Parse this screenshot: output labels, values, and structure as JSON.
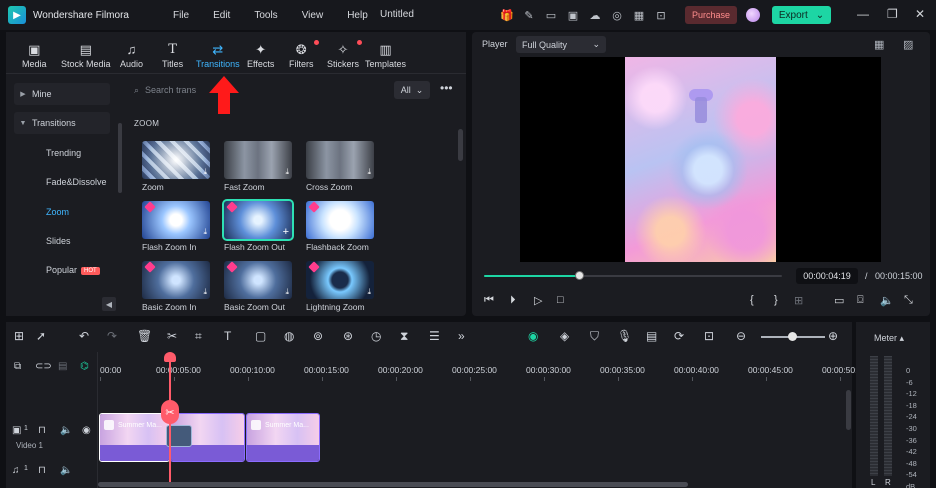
{
  "app": {
    "name": "Wondershare Filmora",
    "doc_title": "Untitled"
  },
  "menu": [
    "File",
    "Edit",
    "Tools",
    "View",
    "Help"
  ],
  "titlebar": {
    "purchase_label": "Purchase",
    "export_label": "Export"
  },
  "tabs": [
    {
      "label": "Media",
      "icon": "media-icon"
    },
    {
      "label": "Stock Media",
      "icon": "stock-media-icon"
    },
    {
      "label": "Audio",
      "icon": "music-note-icon"
    },
    {
      "label": "Titles",
      "icon": "text-icon"
    },
    {
      "label": "Transitions",
      "icon": "transitions-icon",
      "active": true
    },
    {
      "label": "Effects",
      "icon": "sparkle-icon"
    },
    {
      "label": "Filters",
      "icon": "filters-icon"
    },
    {
      "label": "Stickers",
      "icon": "stickers-icon"
    },
    {
      "label": "Templates",
      "icon": "templates-icon"
    }
  ],
  "sidebar": {
    "mine": "Mine",
    "transitions": "Transitions",
    "subitems": [
      "Trending",
      "Fade&Dissolve",
      "Zoom",
      "Slides",
      "Popular"
    ],
    "active": "Zoom",
    "hot_badge": "HOT"
  },
  "search": {
    "placeholder": "Search trans"
  },
  "filter": {
    "value": "All"
  },
  "section": {
    "title": "ZOOM"
  },
  "transitions": [
    {
      "name": "Zoom"
    },
    {
      "name": "Fast Zoom"
    },
    {
      "name": "Cross Zoom"
    },
    {
      "name": "Flash Zoom In"
    },
    {
      "name": "Flash Zoom Out",
      "selected": true
    },
    {
      "name": "Flashback Zoom"
    },
    {
      "name": "Basic Zoom In"
    },
    {
      "name": "Basic Zoom Out"
    },
    {
      "name": "Lightning Zoom"
    }
  ],
  "player": {
    "label": "Player",
    "quality": "Full Quality",
    "current_time": "00:00:04:19",
    "separator": "/",
    "total_time": "00:00:15:00",
    "progress": 0.32
  },
  "timeline": {
    "ruler": [
      "00:00",
      "00:00:05:00",
      "00:00:10:00",
      "00:00:15:00",
      "00:00:20:00",
      "00:00:25:00",
      "00:00:30:00",
      "00:00:35:00",
      "00:00:40:00",
      "00:00:45:00",
      "00:00:50:0"
    ],
    "video_track_name": "Video 1",
    "video_track_num": "1",
    "audio_track_num": "1",
    "clip_labels": [
      "Summer Ma...",
      "",
      "Summer Ma..."
    ]
  },
  "meter": {
    "title": "Meter",
    "scale": [
      "0",
      "-6",
      "-12",
      "-18",
      "-24",
      "-30",
      "-36",
      "-42",
      "-48",
      "-54",
      "dB"
    ],
    "left": "L",
    "right": "R"
  },
  "colors": {
    "accent": "#1dd6a4",
    "active_tab": "#3fb6ff",
    "playhead": "#ff5b6a",
    "clip": "#7a5bd6"
  }
}
